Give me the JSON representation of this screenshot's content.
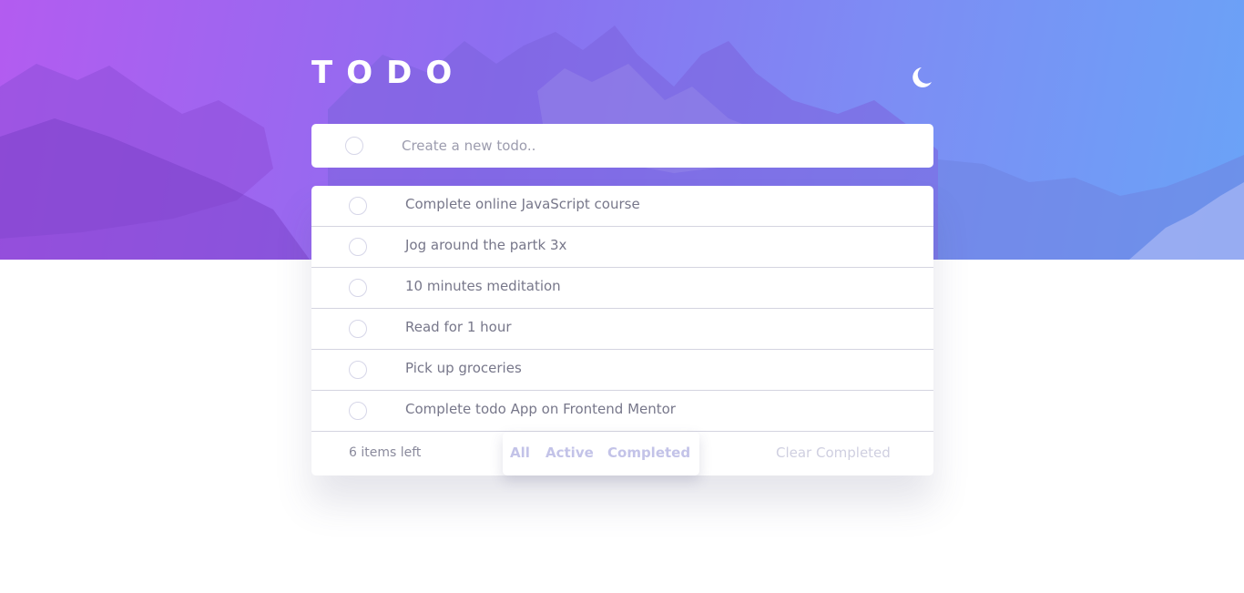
{
  "app": {
    "title": "TODO",
    "theme_toggle_icon": "moon-icon"
  },
  "create": {
    "placeholder": "Create a new todo..",
    "value": ""
  },
  "todos": [
    {
      "text": "Complete online JavaScript course",
      "completed": false
    },
    {
      "text": "Jog around the partk 3x",
      "completed": false
    },
    {
      "text": "10 minutes meditation",
      "completed": false
    },
    {
      "text": "Read for 1 hour",
      "completed": false
    },
    {
      "text": "Pick up groceries",
      "completed": false
    },
    {
      "text": "Complete todo App on Frontend Mentor",
      "completed": false
    }
  ],
  "footer": {
    "items_left": "6 items left",
    "filters": [
      "All",
      "Active",
      "Completed"
    ],
    "clear_label": "Clear Completed"
  },
  "colors": {
    "gradient_start": "#b35cf0",
    "gradient_end": "#6aa3f7",
    "filter_text": "#c3c3e8",
    "todo_text": "#77778a"
  }
}
